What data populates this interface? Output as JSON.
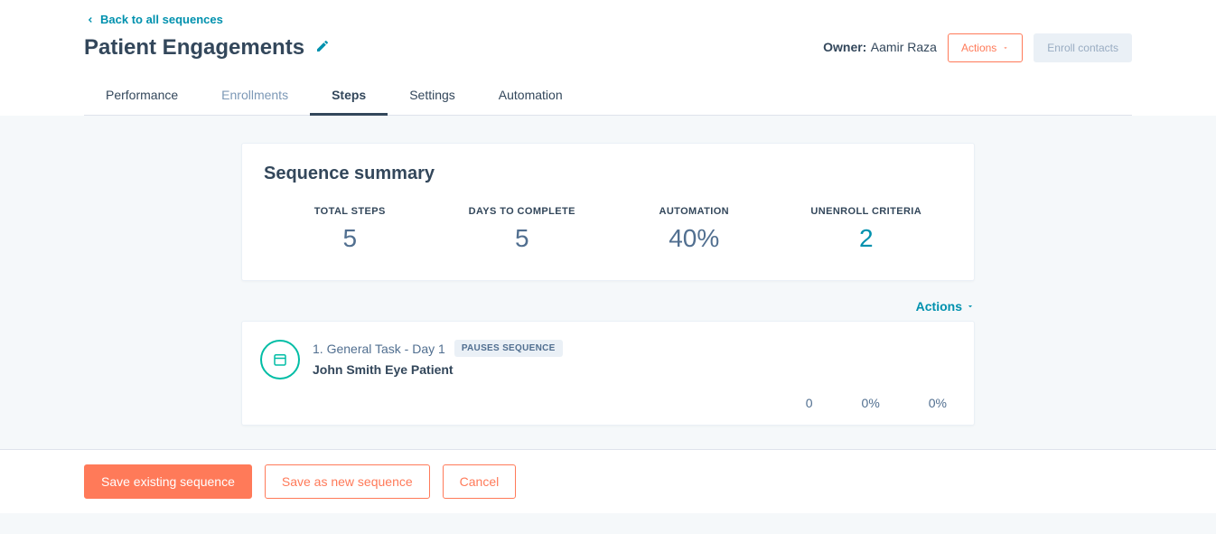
{
  "back_link": "Back to all sequences",
  "page_title": "Patient Engagements",
  "owner": {
    "label": "Owner:",
    "name": "Aamir Raza"
  },
  "header_buttons": {
    "actions": "Actions",
    "enroll": "Enroll contacts"
  },
  "tabs": [
    "Performance",
    "Enrollments",
    "Steps",
    "Settings",
    "Automation"
  ],
  "summary": {
    "title": "Sequence summary",
    "stats": [
      {
        "label": "TOTAL STEPS",
        "value": "5"
      },
      {
        "label": "DAYS TO COMPLETE",
        "value": "5"
      },
      {
        "label": "AUTOMATION",
        "value": "40%"
      },
      {
        "label": "UNENROLL CRITERIA",
        "value": "2"
      }
    ]
  },
  "card_actions": "Actions",
  "step": {
    "line1": "1. General Task - Day 1",
    "badge": "PAUSES SEQUENCE",
    "line2": "John Smith Eye Patient",
    "stats": [
      "0",
      "0%",
      "0%"
    ]
  },
  "footer": {
    "save_existing": "Save existing sequence",
    "save_new": "Save as new sequence",
    "cancel": "Cancel"
  }
}
